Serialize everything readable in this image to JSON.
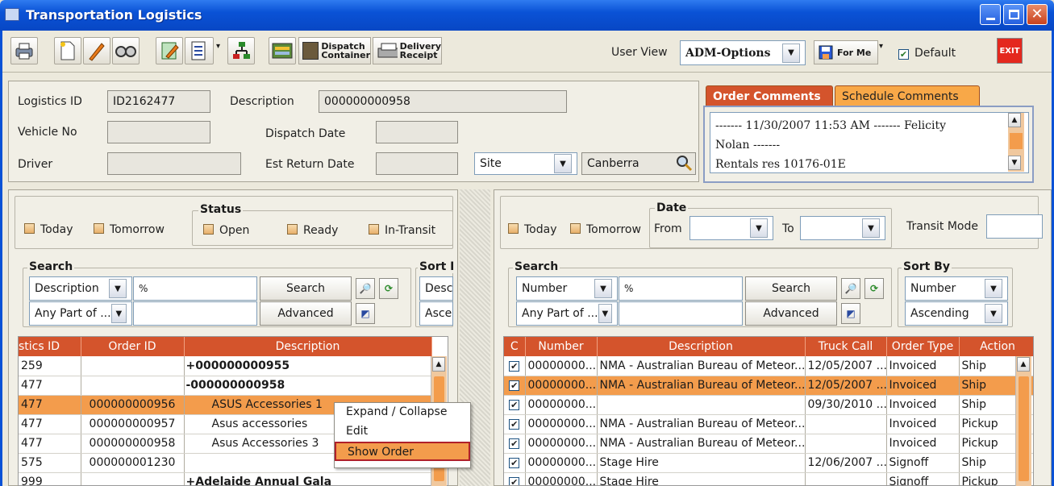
{
  "window": {
    "title": "Transportation Logistics"
  },
  "toolbar": {
    "dispatch_label_1": "Dispatch",
    "dispatch_label_2": "Container",
    "delivery_label_1": "Delivery",
    "delivery_label_2": "Receipt",
    "user_view_label": "User View",
    "user_view_value": "ADM-Options",
    "for_me_label": "For Me",
    "default_label": "Default",
    "exit_label": "EXIT"
  },
  "header": {
    "logistics_id_label": "Logistics ID",
    "logistics_id_value": "ID2162477",
    "description_label": "Description",
    "description_value": "000000000958",
    "vehicle_no_label": "Vehicle No",
    "vehicle_no_value": "",
    "dispatch_date_label": "Dispatch Date",
    "dispatch_date_value": "",
    "driver_label": "Driver",
    "driver_value": "",
    "est_return_label": "Est Return Date",
    "est_return_value": "",
    "site_label": "Site",
    "site_value": "Canberra"
  },
  "comments": {
    "tab_order": "Order Comments",
    "tab_schedule": "Schedule Comments",
    "line1": "------- 11/30/2007 11:53 AM ------- Felicity",
    "line2": "Nolan -------",
    "line3": "Rentals res 10176-01E"
  },
  "left": {
    "today": "Today",
    "tomorrow": "Tomorrow",
    "status_title": "Status",
    "open": "Open",
    "ready": "Ready",
    "in_transit": "In-Transit",
    "search_title": "Search",
    "search_field": "Description",
    "search_match": "Any Part of ...",
    "search_value": "%",
    "search_btn": "Search",
    "advanced_btn": "Advanced",
    "sort_title": "Sort I",
    "sort_field": "Desc",
    "sort_dir": "Asce",
    "columns": [
      "stics ID",
      "Order ID",
      "Description"
    ],
    "rows": [
      {
        "id": "259",
        "order": "",
        "desc": "+000000000955",
        "bold": true
      },
      {
        "id": "477",
        "order": "",
        "desc": "-000000000958",
        "bold": true
      },
      {
        "id": "477",
        "order": "000000000956",
        "desc": "ASUS Accessories 1",
        "sel": true
      },
      {
        "id": "477",
        "order": "000000000957",
        "desc": "Asus accessories"
      },
      {
        "id": "477",
        "order": "000000000958",
        "desc": "Asus Accessories 3"
      },
      {
        "id": "575",
        "order": "000000001230",
        "desc": ""
      },
      {
        "id": "999",
        "order": "",
        "desc": "+Adelaide Annual Gala",
        "bold": true
      }
    ]
  },
  "context_menu": {
    "items": [
      "Expand / Collapse",
      "Edit",
      "Show Order"
    ]
  },
  "right": {
    "today": "Today",
    "tomorrow": "Tomorrow",
    "date_title": "Date",
    "from": "From",
    "to": "To",
    "transit_mode": "Transit Mode",
    "search_title": "Search",
    "search_field": "Number",
    "search_match": "Any Part of ...",
    "search_value": "%",
    "search_btn": "Search",
    "advanced_btn": "Advanced",
    "sort_title": "Sort By",
    "sort_field": "Number",
    "sort_dir": "Ascending",
    "columns": [
      "C",
      "Number",
      "Description",
      "Truck Call",
      "Order Type",
      "Action"
    ],
    "rows": [
      {
        "num": "00000000...",
        "desc": "NMA - Australian Bureau of Meteor...",
        "truck": "12/05/2007 ...",
        "type": "Invoiced",
        "action": "Ship"
      },
      {
        "num": "00000000...",
        "desc": "NMA - Australian Bureau of Meteor...",
        "truck": "12/05/2007 ...",
        "type": "Invoiced",
        "action": "Ship",
        "sel": true
      },
      {
        "num": "00000000...",
        "desc": "",
        "truck": "09/30/2010 ...",
        "type": "Invoiced",
        "action": "Ship"
      },
      {
        "num": "00000000...",
        "desc": "NMA - Australian Bureau of Meteor...",
        "truck": "",
        "type": "Invoiced",
        "action": "Pickup"
      },
      {
        "num": "00000000...",
        "desc": "NMA - Australian Bureau of Meteor...",
        "truck": "",
        "type": "Invoiced",
        "action": "Pickup"
      },
      {
        "num": "00000000...",
        "desc": "Stage Hire",
        "truck": "12/06/2007 ...",
        "type": "Signoff",
        "action": "Ship"
      },
      {
        "num": "00000000...",
        "desc": "Stage Hire",
        "truck": "",
        "type": "Signoff",
        "action": "Pickup"
      }
    ]
  }
}
